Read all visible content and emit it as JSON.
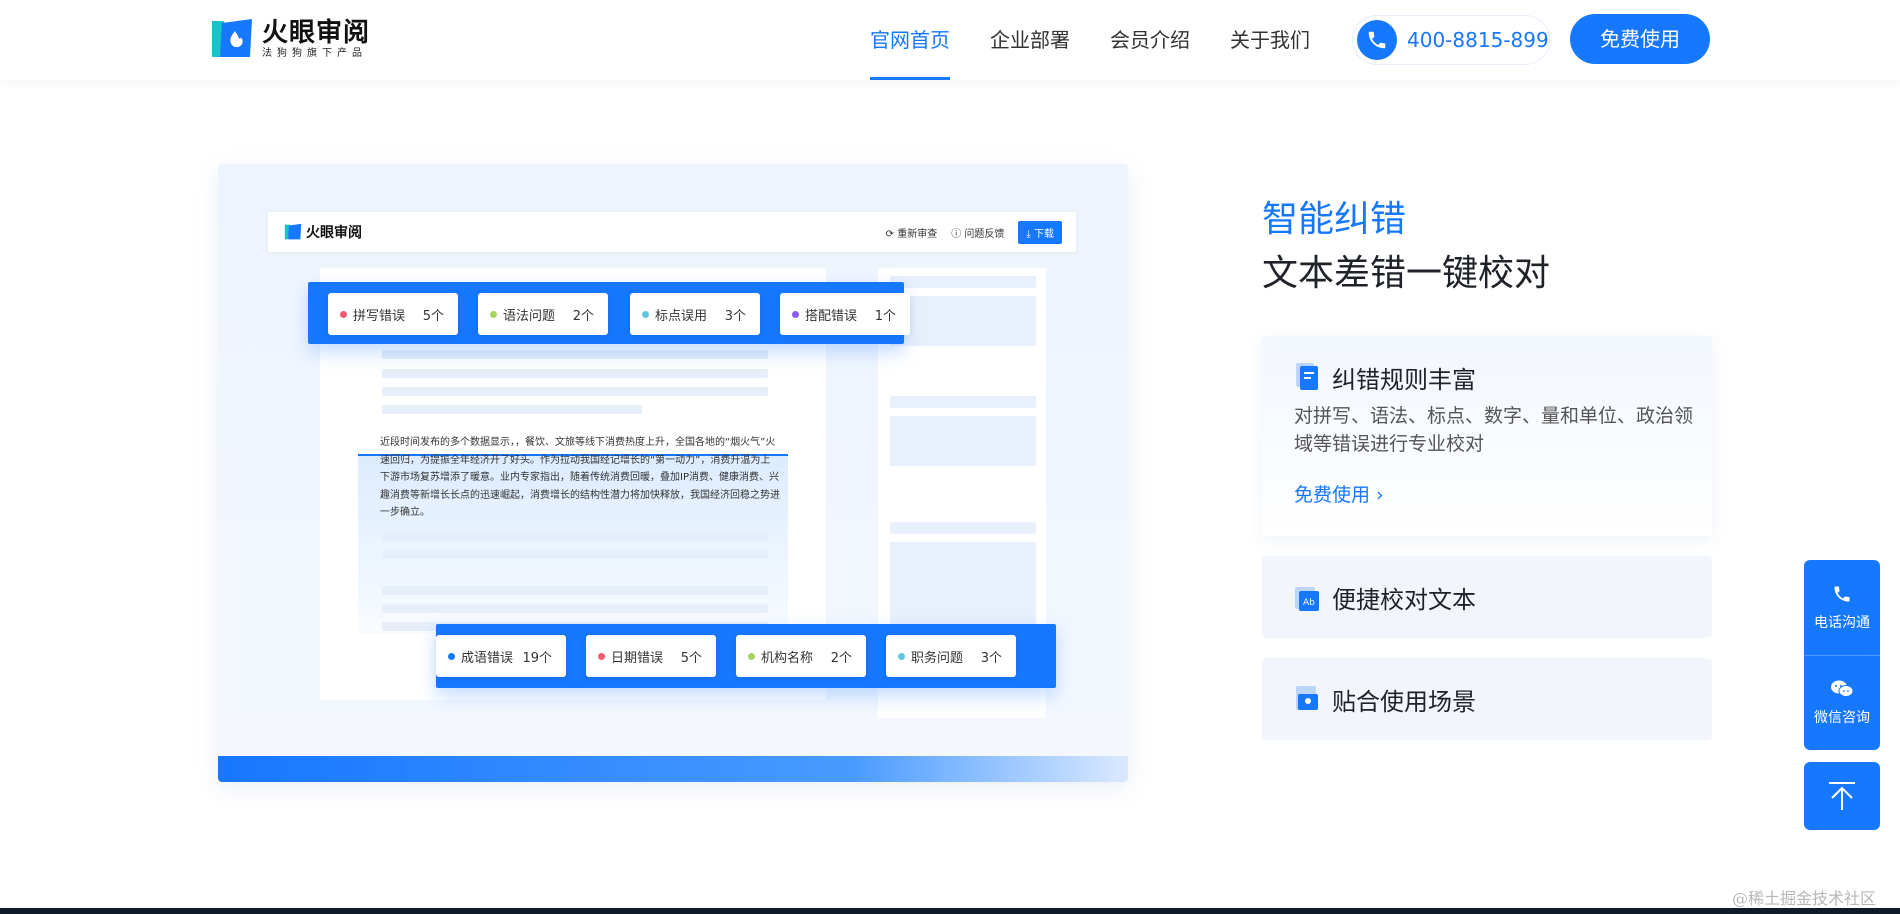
{
  "header": {
    "logo_title": "火眼审阅",
    "logo_subtitle": "法狗狗旗下产品",
    "nav": [
      {
        "label": "官网首页",
        "active": true
      },
      {
        "label": "企业部署",
        "active": false
      },
      {
        "label": "会员介绍",
        "active": false
      },
      {
        "label": "关于我们",
        "active": false
      }
    ],
    "phone": "400-8815-899",
    "cta_label": "免费使用"
  },
  "demo": {
    "app_logo": "火眼审阅",
    "actions": {
      "refresh": "重新审查",
      "feedback": "问题反馈",
      "download": "下载"
    },
    "doc_text": "近段时间发布的多个数据显示，，餐饮、文旅等线下消费热度上升，全国各地的“烟火气”火速回归，为提振全年经济开了好头。作为拉动我国经记增长的“第一动力”，消费升温为上下游市场复苏增添了暖意。业内专家指出，随着传统消费回暖，叠加IP消费、健康消费、兴趣消费等新增长长点的迅速崛起，消费增长的结构性潜力将加快释放，我国经济回稳之势进一步确立。",
    "tags_top": [
      {
        "label": "拼写错误",
        "count": "5个",
        "color": "#f25b6e"
      },
      {
        "label": "语法问题",
        "count": "2个",
        "color": "#a3d65a"
      },
      {
        "label": "标点误用",
        "count": "3个",
        "color": "#5ac8e0"
      },
      {
        "label": "搭配错误",
        "count": "1个",
        "color": "#8b5cf6"
      }
    ],
    "tags_bottom": [
      {
        "label": "成语错误",
        "count": "19个",
        "color": "#1677ff"
      },
      {
        "label": "日期错误",
        "count": "5个",
        "color": "#f25b6e"
      },
      {
        "label": "机构名称",
        "count": "2个",
        "color": "#a3d65a"
      },
      {
        "label": "职务问题",
        "count": "3个",
        "color": "#5ac8e0"
      }
    ]
  },
  "feature": {
    "kicker": "智能纠错",
    "title": "文本差错一键校对",
    "cards": [
      {
        "title": "纠错规则丰富",
        "icon": "document-check-icon",
        "desc": "对拼写、语法、标点、数字、量和单位、政治领域等错误进行专业校对",
        "link": "免费使用"
      },
      {
        "title": "便捷校对文本",
        "icon": "text-proof-icon"
      },
      {
        "title": "贴合使用场景",
        "icon": "scene-icon"
      }
    ]
  },
  "float": {
    "phone_label": "电话沟通",
    "wechat_label": "微信咨询"
  },
  "watermark": "@稀土掘金技术社区",
  "colors": {
    "primary": "#1677ff"
  }
}
